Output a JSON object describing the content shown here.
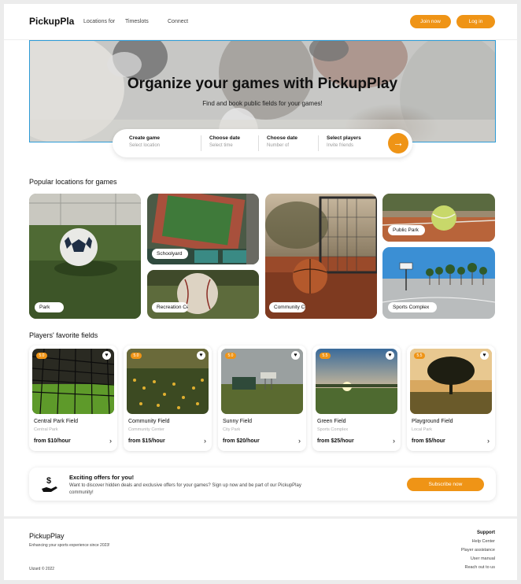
{
  "header": {
    "logo": "PickupPla",
    "nav": [
      "Locations for",
      "Timeslots",
      "Connect"
    ],
    "join_label": "Join now",
    "login_label": "Log in"
  },
  "hero": {
    "title": "Organize your games with PickupPlay",
    "subtitle": "Find and book public fields for your games!"
  },
  "search": {
    "fields": [
      {
        "label": "Create game",
        "placeholder": "Select location"
      },
      {
        "label": "Choose date",
        "placeholder": "Select time"
      },
      {
        "label": "Choose date",
        "placeholder": "Number of"
      },
      {
        "label": "Select players",
        "placeholder": "Invite friends"
      }
    ],
    "go_icon": "arrow-right-icon"
  },
  "popular": {
    "title": "Popular locations for games",
    "tiles": [
      {
        "label": "Park"
      },
      {
        "label": "Schoolyard"
      },
      {
        "label": "Recreation Center"
      },
      {
        "label": "Community Court"
      },
      {
        "label": "Public Park"
      },
      {
        "label": "Sports Complex"
      }
    ]
  },
  "favorites": {
    "title": "Players' favorite fields",
    "cards": [
      {
        "rating": "5.0",
        "name": "Central Park Field",
        "location": "Central Park",
        "price": "from $10/hour"
      },
      {
        "rating": "5.0",
        "name": "Community Field",
        "location": "Community Center",
        "price": "from $15/hour"
      },
      {
        "rating": "5.0",
        "name": "Sunny Field",
        "location": "City Park",
        "price": "from $20/hour"
      },
      {
        "rating": "5.5",
        "name": "Green Field",
        "location": "Sports Complex",
        "price": "from $25/hour"
      },
      {
        "rating": "5.5",
        "name": "Playground Field",
        "location": "Local Park",
        "price": "from $5/hour"
      }
    ]
  },
  "offer": {
    "title": "Exciting offers for you!",
    "text": "Want to discover hidden deals and exclusive offers for your games? Sign up now and be part of our PickupPlay community!",
    "button": "Subscribe now"
  },
  "footer": {
    "brand": "PickupPlay",
    "tagline": "Enhancing your sports experience since 2023!",
    "copyright": "Uizard © 2022",
    "support_title": "Support",
    "links": [
      "Help Center",
      "Player assistance",
      "User manual",
      "Reach out to us"
    ]
  },
  "colors": {
    "accent": "#ef9416",
    "hero_border": "#2d9bd6"
  }
}
